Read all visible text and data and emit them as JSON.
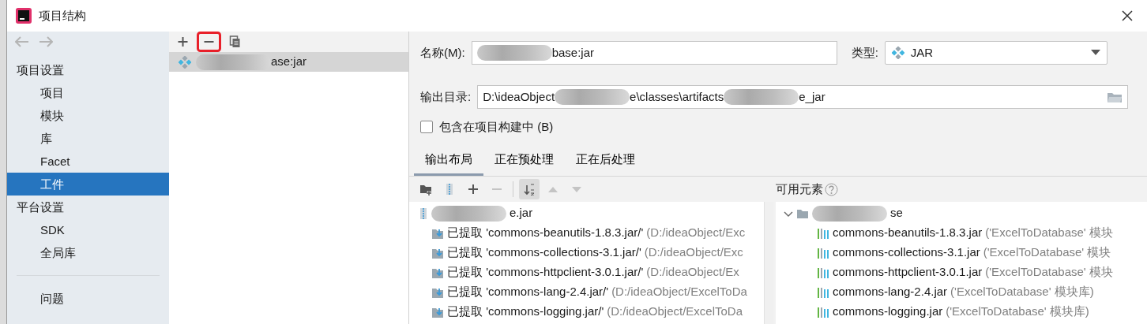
{
  "window": {
    "title": "项目结构"
  },
  "sidebar": {
    "sections": [
      {
        "heading": "项目设置",
        "items": [
          {
            "label": "项目",
            "selected": false
          },
          {
            "label": "模块",
            "selected": false
          },
          {
            "label": "库",
            "selected": false
          },
          {
            "label": "Facet",
            "selected": false
          },
          {
            "label": "工件",
            "selected": true
          }
        ]
      },
      {
        "heading": "平台设置",
        "items": [
          {
            "label": "SDK",
            "selected": false
          },
          {
            "label": "全局库",
            "selected": false
          }
        ]
      }
    ],
    "footer_items": [
      {
        "label": "问题",
        "selected": false
      }
    ]
  },
  "artifacts": {
    "toolbar": [
      {
        "kind": "add",
        "highlighted": false
      },
      {
        "kind": "remove",
        "highlighted": true
      },
      {
        "kind": "copy",
        "highlighted": false
      }
    ],
    "items": [
      {
        "selected": true,
        "name_parts": [
          {
            "kind": "blur"
          },
          {
            "kind": "text",
            "text": "ase:jar"
          }
        ]
      }
    ]
  },
  "form": {
    "name_label": "名称(M):",
    "name_parts": [
      {
        "kind": "blur"
      },
      {
        "kind": "text",
        "text": "base:jar"
      }
    ],
    "type_label": "类型:",
    "type_value": "JAR",
    "output_label": "输出目录:",
    "output_parts": [
      {
        "kind": "text",
        "text": "D:\\ideaObject"
      },
      {
        "kind": "blur"
      },
      {
        "kind": "text",
        "text": "e\\classes\\artifacts"
      },
      {
        "kind": "blur"
      },
      {
        "kind": "text",
        "text": "e_jar"
      }
    ],
    "include_label": "包含在项目构建中 (B)",
    "include_checked": false
  },
  "tabs": [
    {
      "label": "输出布局",
      "selected": true
    },
    {
      "label": "正在预处理",
      "selected": false
    },
    {
      "label": "正在后处理",
      "selected": false
    }
  ],
  "layout_toolbar": [
    {
      "kind": "new-folder",
      "disabled": false,
      "on": false
    },
    {
      "kind": "archive",
      "disabled": false,
      "on": false
    },
    {
      "kind": "add",
      "disabled": false,
      "on": false
    },
    {
      "kind": "remove",
      "disabled": true,
      "on": false
    },
    {
      "kind": "sort",
      "disabled": false,
      "on": true
    },
    {
      "kind": "up",
      "disabled": true,
      "on": false
    },
    {
      "kind": "down",
      "disabled": true,
      "on": false
    }
  ],
  "output_tree": {
    "root_parts": [
      {
        "kind": "blur"
      },
      {
        "kind": "text",
        "text": "e.jar"
      }
    ],
    "children": [
      {
        "name": "已提取 'commons-beanutils-1.8.3.jar/'",
        "detail": "(D:/ideaObject/Exc"
      },
      {
        "name": "已提取 'commons-collections-3.1.jar/'",
        "detail": "(D:/ideaObject/Exc"
      },
      {
        "name": "已提取 'commons-httpclient-3.0.1.jar/'",
        "detail": "(D:/ideaObject/Ex"
      },
      {
        "name": "已提取 'commons-lang-2.4.jar/'",
        "detail": "(D:/ideaObject/ExcelToDa"
      },
      {
        "name": "已提取 'commons-logging.jar/'",
        "detail": "(D:/ideaObject/ExcelToDa"
      }
    ]
  },
  "available": {
    "title": "可用元素",
    "root_expanded": true,
    "root_parts": [
      {
        "kind": "blur"
      },
      {
        "kind": "text",
        "text": "se"
      }
    ],
    "children": [
      {
        "name": "commons-beanutils-1.8.3.jar",
        "detail": "('ExcelToDatabase' 模块"
      },
      {
        "name": "commons-collections-3.1.jar",
        "detail": "('ExcelToDatabase' 模块"
      },
      {
        "name": "commons-httpclient-3.0.1.jar",
        "detail": "('ExcelToDatabase' 模块"
      },
      {
        "name": "commons-lang-2.4.jar",
        "detail": "('ExcelToDatabase' 模块库)"
      },
      {
        "name": "commons-logging.jar",
        "detail": "('ExcelToDatabase' 模块库)"
      }
    ]
  }
}
